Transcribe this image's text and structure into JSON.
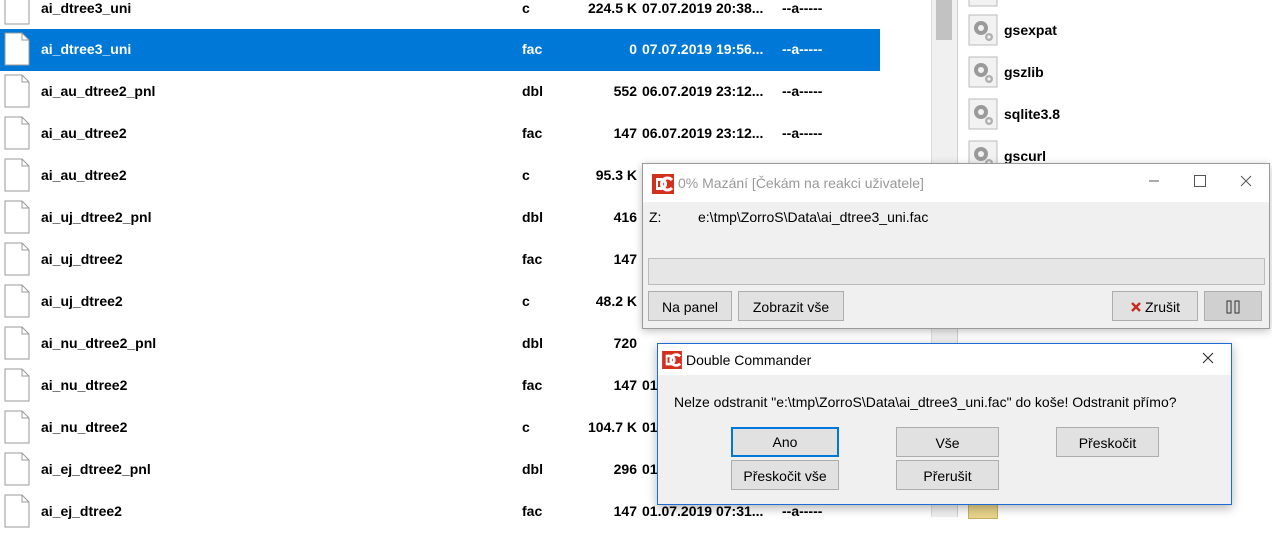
{
  "files": [
    {
      "name": "ai_dtree3_uni",
      "ext": "c",
      "size": "224.5 K",
      "date": "07.07.2019 20:38...",
      "attr": "--a-----"
    },
    {
      "name": "ai_dtree3_uni",
      "ext": "fac",
      "size": "0",
      "date": "07.07.2019 19:56...",
      "attr": "--a-----",
      "selected": true
    },
    {
      "name": "ai_au_dtree2_pnl",
      "ext": "dbl",
      "size": "552",
      "date": "06.07.2019 23:12...",
      "attr": "--a-----"
    },
    {
      "name": "ai_au_dtree2",
      "ext": "fac",
      "size": "147",
      "date": "06.07.2019 23:12...",
      "attr": "--a-----"
    },
    {
      "name": "ai_au_dtree2",
      "ext": "c",
      "size": "95.3 K",
      "date": "",
      "attr": ""
    },
    {
      "name": "ai_uj_dtree2_pnl",
      "ext": "dbl",
      "size": "416",
      "date": "",
      "attr": ""
    },
    {
      "name": "ai_uj_dtree2",
      "ext": "fac",
      "size": "147",
      "date": "",
      "attr": ""
    },
    {
      "name": "ai_uj_dtree2",
      "ext": "c",
      "size": "48.2 K",
      "date": "",
      "attr": ""
    },
    {
      "name": "ai_nu_dtree2_pnl",
      "ext": "dbl",
      "size": "720",
      "date": "",
      "attr": ""
    },
    {
      "name": "ai_nu_dtree2",
      "ext": "fac",
      "size": "147",
      "date": "01",
      "attr": ""
    },
    {
      "name": "ai_nu_dtree2",
      "ext": "c",
      "size": "104.7 K",
      "date": "01",
      "attr": ""
    },
    {
      "name": "ai_ej_dtree2_pnl",
      "ext": "dbl",
      "size": "296",
      "date": "01",
      "attr": ""
    },
    {
      "name": "ai_ej_dtree2",
      "ext": "fac",
      "size": "147",
      "date": "01.07.2019 07:31...",
      "attr": "--a-----"
    }
  ],
  "right_panel": {
    "items": [
      {
        "label": "gsexpat"
      },
      {
        "label": "gszlib"
      },
      {
        "label": "sqlite3.8"
      },
      {
        "label": "gscurl"
      }
    ]
  },
  "progress_dialog": {
    "title": "0% Mazání [Čekám na reakci uživatele]",
    "label": "Z:",
    "path": "e:\\tmp\\ZorroS\\Data\\ai_dtree3_uni.fac",
    "progress": 0,
    "buttons": {
      "to_panel": "Na panel",
      "show_all": "Zobrazit vše",
      "cancel": "Zrušit"
    }
  },
  "confirm_dialog": {
    "title": "Double Commander",
    "message": "Nelze odstranit \"e:\\tmp\\ZorroS\\Data\\ai_dtree3_uni.fac\" do koše! Odstranit přímo?",
    "buttons": {
      "yes": "Ano",
      "all": "Vše",
      "skip": "Přeskočit",
      "skip_all": "Přeskočit vše",
      "abort": "Přerušit"
    }
  },
  "colors": {
    "selection": "#0078d7",
    "cancel_icon": "#c42b1c",
    "app_icon": "#d32f1f"
  }
}
